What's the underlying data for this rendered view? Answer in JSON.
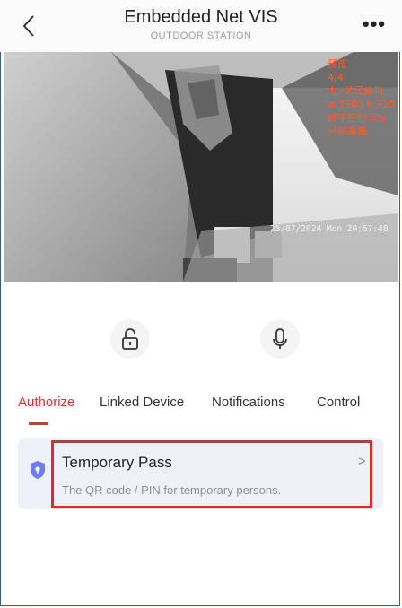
{
  "header": {
    "title": "Embedded Net VIS",
    "subtitle": "OUTDOOR STATION"
  },
  "video": {
    "osd_lines": [
      "预览",
      "4/4",
      "主: 关闭蜂鸣",
      "w:1280 h:720",
      "帧率控制:5%",
      "分辨率量:"
    ],
    "timestamp": "25/07/2024 Mon 20:57:48"
  },
  "controls": {
    "unlock_icon": "lock-open-icon",
    "mic_icon": "microphone-icon"
  },
  "tabs": [
    {
      "label": "Authorize",
      "active": true
    },
    {
      "label": "Linked Device",
      "active": false
    },
    {
      "label": "Notifications",
      "active": false
    },
    {
      "label": "Control",
      "active": false
    }
  ],
  "card": {
    "icon": "shield-icon",
    "title": "Temporary Pass",
    "description": "The QR code / PIN for temporary persons.",
    "chevron": ">"
  },
  "colors": {
    "accent": "#e03030",
    "highlight_border": "#d92c2c",
    "card_bg": "#eef2f8",
    "shield": "#6f7cf0"
  }
}
